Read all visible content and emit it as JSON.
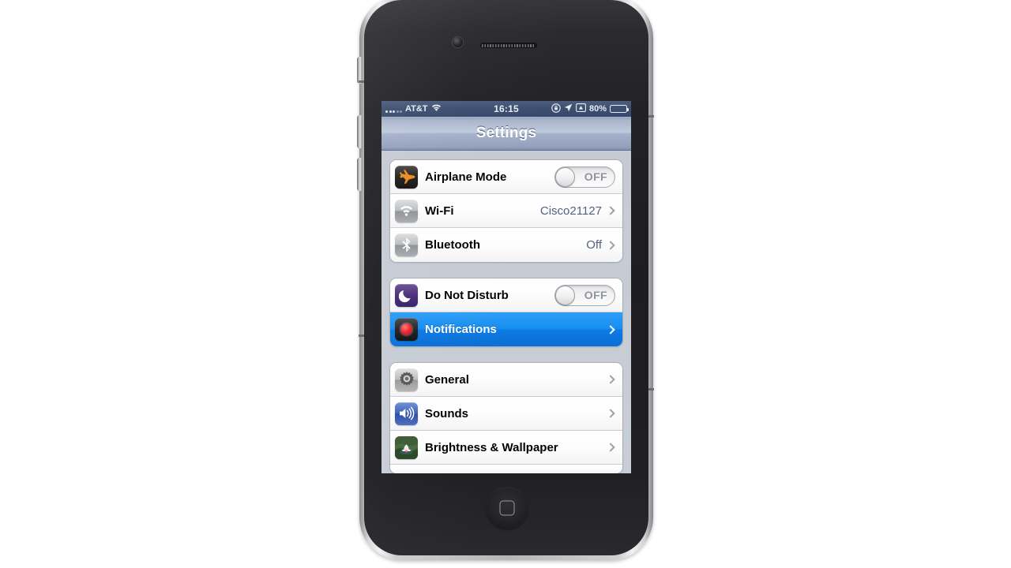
{
  "device": {
    "name": "iphone-4s-black",
    "hardware": {
      "camera": "front-camera",
      "earpiece": "earpiece-speaker",
      "home_button": "home-button",
      "mute_switch": "mute-switch",
      "volume_up": "volume-up-button",
      "volume_down": "volume-down-button",
      "power": "power-button"
    }
  },
  "status_bar": {
    "carrier": "AT&T",
    "signal_icon": "signal-bars-icon",
    "wifi_icon": "wifi-icon",
    "time": "16:15",
    "rotation_lock_icon": "rotation-lock-icon",
    "location_icon": "location-arrow-icon",
    "airplay_icon": "airplay-icon",
    "battery_percent": "80%",
    "battery_icon": "battery-icon",
    "battery_level": 80
  },
  "nav_bar": {
    "title": "Settings"
  },
  "groups": [
    {
      "id": "connectivity",
      "rows": [
        {
          "label": "Airplane Mode",
          "icon": "airplane-icon",
          "accessory": "switch",
          "switch_label": "OFF",
          "switch_on": false,
          "selected": false
        },
        {
          "label": "Wi-Fi",
          "icon": "wifi-icon",
          "accessory": "disclosure",
          "value": "Cisco21127",
          "selected": false
        },
        {
          "label": "Bluetooth",
          "icon": "bluetooth-icon",
          "accessory": "disclosure",
          "value": "Off",
          "selected": false
        }
      ]
    },
    {
      "id": "alerts",
      "rows": [
        {
          "label": "Do Not Disturb",
          "icon": "moon-icon",
          "accessory": "switch",
          "switch_label": "OFF",
          "switch_on": false,
          "selected": false
        },
        {
          "label": "Notifications",
          "icon": "notifications-icon",
          "accessory": "disclosure",
          "value": "",
          "selected": true
        }
      ]
    },
    {
      "id": "system",
      "rows": [
        {
          "label": "General",
          "icon": "gear-icon",
          "accessory": "disclosure",
          "value": "",
          "selected": false
        },
        {
          "label": "Sounds",
          "icon": "speaker-icon",
          "accessory": "disclosure",
          "value": "",
          "selected": false
        },
        {
          "label": "Brightness & Wallpaper",
          "icon": "flower-wallpaper-icon",
          "accessory": "disclosure",
          "value": "",
          "selected": false
        }
      ]
    }
  ],
  "colors": {
    "selection_blue": "#168ef0",
    "status_bar": "#3f4f70",
    "nav_bar": "#aab4ca",
    "value_text": "#56607f",
    "table_background": "#c9ced6",
    "row_background": "#ffffff"
  }
}
